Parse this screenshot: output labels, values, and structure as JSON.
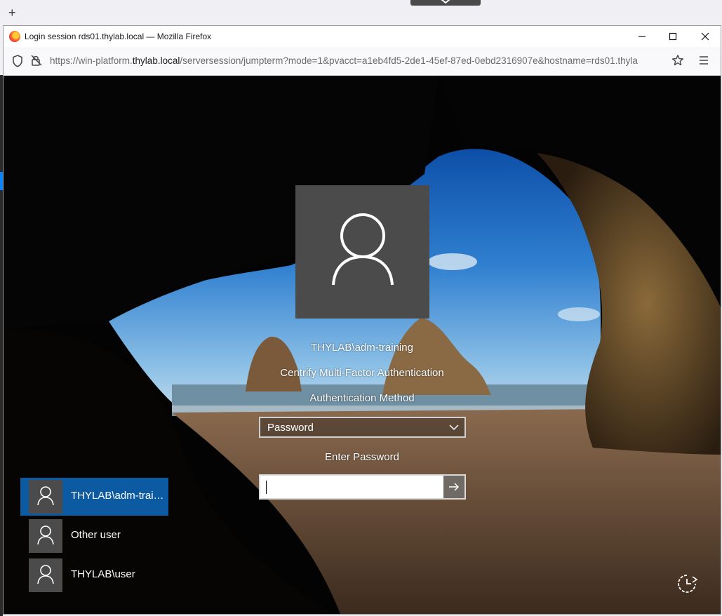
{
  "outer_browser": {
    "new_tab_icon": "plus-icon",
    "toggle_icon": "chevron-down-icon"
  },
  "window": {
    "title": "Login session rds01.thylab.local — Mozilla Firefox",
    "controls": [
      "minimize-icon",
      "maximize-icon",
      "close-icon"
    ]
  },
  "urlbar": {
    "url_prefix": "https://win-platform.",
    "url_host": "thylab.local",
    "url_rest": "/serversession/jumpterm?mode=1&pvacct=a1eb4fd5-2de1-45ef-87ed-0ebd2316907e&hostname=rds01.thyla",
    "icons": [
      "shield-icon",
      "lock-icon",
      "star-icon",
      "menu-icon"
    ]
  },
  "login": {
    "username": "THYLAB\\adm-training",
    "provider": "Centrify Multi-Factor Authentication",
    "method_label": "Authentication Method",
    "method_selected": "Password",
    "password_label": "Enter Password",
    "password_value": "",
    "submit_icon": "arrow-right-icon"
  },
  "users": [
    {
      "name": "THYLAB\\adm-training",
      "selected": true
    },
    {
      "name": "Other user",
      "selected": false
    },
    {
      "name": "THYLAB\\user",
      "selected": false
    }
  ],
  "ease_of_access_icon": "ease-of-access-icon",
  "colors": {
    "selected_user": "#0b5aa2",
    "avatar_tile": "#4b4b4b"
  }
}
